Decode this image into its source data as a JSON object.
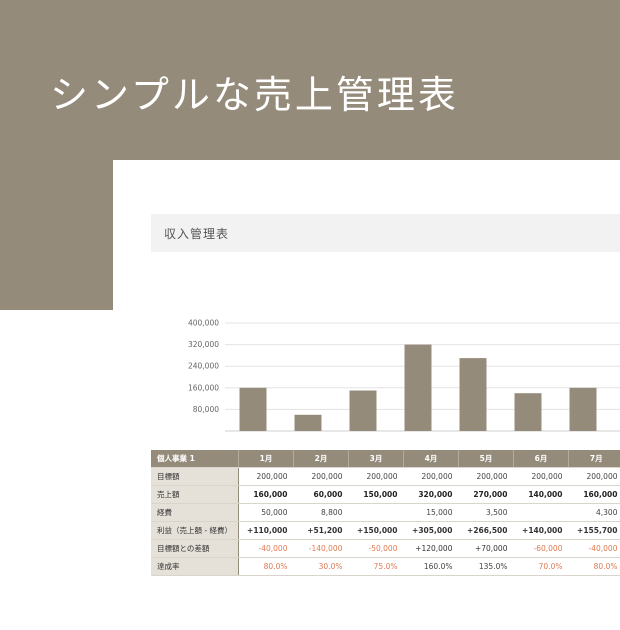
{
  "hero": {
    "title": "シンプルな売上管理表"
  },
  "card": {
    "title": "収入管理表"
  },
  "colors": {
    "accent": "#958b7b",
    "negative": "#e07a52",
    "label_bg": "#e5e0d8"
  },
  "chart_data": {
    "type": "bar",
    "categories": [
      "1月",
      "2月",
      "3月",
      "4月",
      "5月",
      "6月",
      "7月"
    ],
    "values": [
      160000,
      60000,
      150000,
      320000,
      270000,
      140000,
      160000
    ],
    "y_ticks": [
      "80,000",
      "160,000",
      "240,000",
      "320,000",
      "400,000"
    ],
    "ylim": [
      0,
      400000
    ],
    "grid": true
  },
  "table": {
    "corner": "個人事業 1",
    "months": [
      "1月",
      "2月",
      "3月",
      "4月",
      "5月",
      "6月",
      "7月"
    ],
    "rows": [
      {
        "label": "目標額",
        "cells": [
          "200,000",
          "200,000",
          "200,000",
          "200,000",
          "200,000",
          "200,000",
          "200,000"
        ]
      },
      {
        "label": "売上額",
        "cells": [
          "160,000",
          "60,000",
          "150,000",
          "320,000",
          "270,000",
          "140,000",
          "160,000"
        ]
      },
      {
        "label": "経費",
        "cells": [
          "50,000",
          "8,800",
          "",
          "15,000",
          "3,500",
          "",
          "4,300"
        ]
      },
      {
        "label": "利益（売上額 - 経費）",
        "cells": [
          "+110,000",
          "+51,200",
          "+150,000",
          "+305,000",
          "+266,500",
          "+140,000",
          "+155,700"
        ]
      },
      {
        "label": "目標額との差額",
        "cells": [
          "-40,000",
          "-140,000",
          "-50,000",
          "+120,000",
          "+70,000",
          "-60,000",
          "-40,000"
        ]
      },
      {
        "label": "達成率",
        "cells": [
          "80.0%",
          "30.0%",
          "75.0%",
          "160.0%",
          "135.0%",
          "70.0%",
          "80.0%"
        ]
      }
    ]
  }
}
